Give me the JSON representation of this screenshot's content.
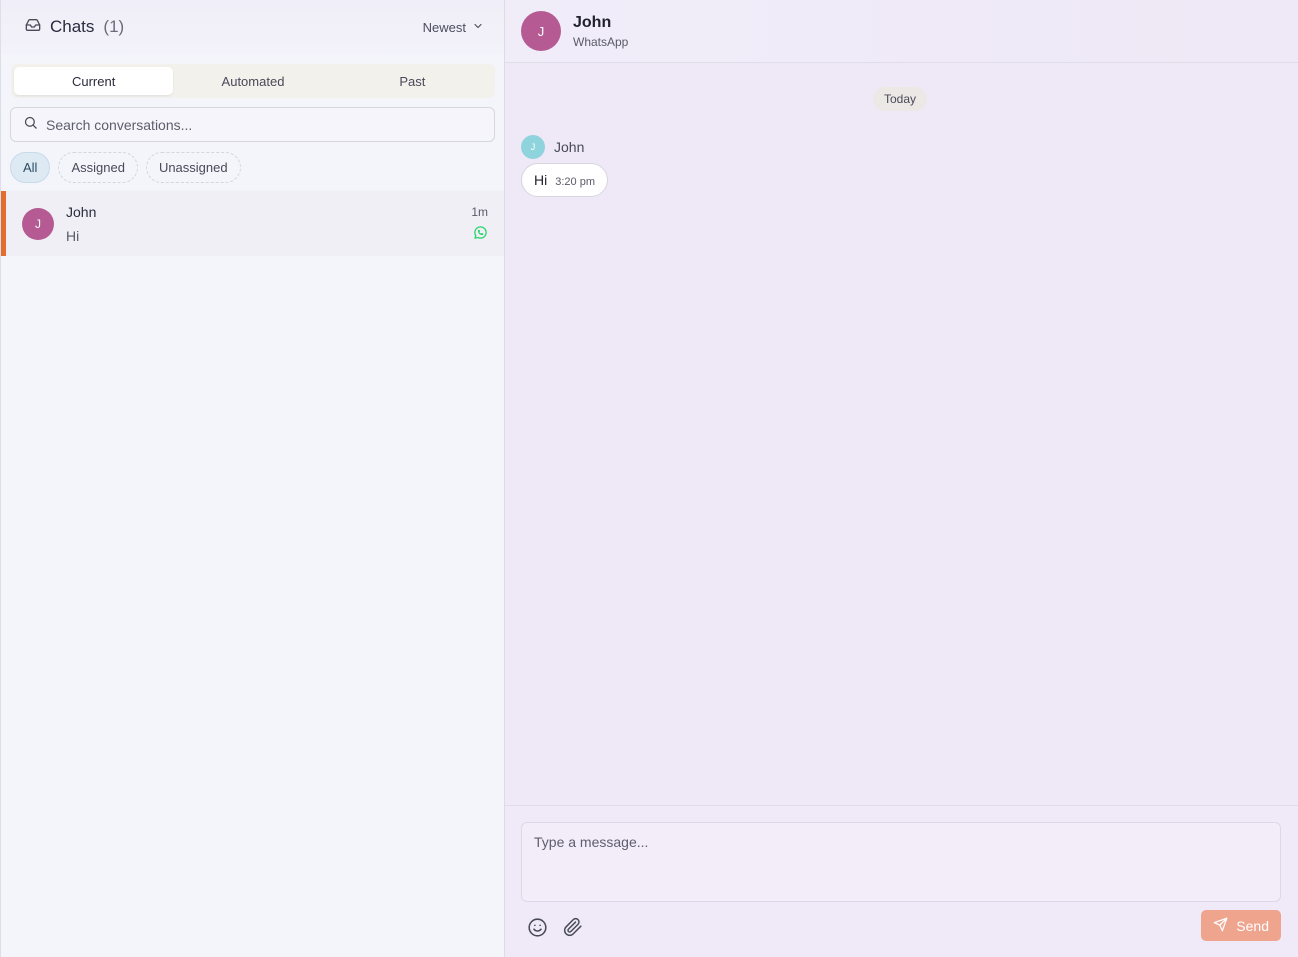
{
  "sidebar": {
    "title": "Chats",
    "count": "(1)",
    "sort_label": "Newest",
    "tabs": [
      {
        "label": "Current",
        "active": true
      },
      {
        "label": "Automated",
        "active": false
      },
      {
        "label": "Past",
        "active": false
      }
    ],
    "search": {
      "placeholder": "Search conversations..."
    },
    "filters": [
      {
        "label": "All",
        "active": true
      },
      {
        "label": "Assigned",
        "active": false
      },
      {
        "label": "Unassigned",
        "active": false
      }
    ],
    "conversations": [
      {
        "initial": "J",
        "name": "John",
        "preview": "Hi",
        "time": "1m",
        "channel_icon": "whatsapp-icon",
        "selected": true
      }
    ]
  },
  "chat": {
    "contact": {
      "initial": "J",
      "name": "John",
      "channel": "WhatsApp"
    },
    "day_label": "Today",
    "messages": [
      {
        "sender_initial": "J",
        "sender_name": "John",
        "text": "Hi",
        "time": "3:20 pm"
      }
    ]
  },
  "composer": {
    "placeholder": "Type a message...",
    "send_label": "Send",
    "icons": [
      "emoji-icon",
      "paperclip-icon",
      "send-icon"
    ]
  },
  "colors": {
    "accent": "#e36d2e",
    "avatar": "#b55a92",
    "sender_avatar": "#8fd3dc",
    "whatsapp": "#25d366",
    "send_button": "#eea48d"
  }
}
